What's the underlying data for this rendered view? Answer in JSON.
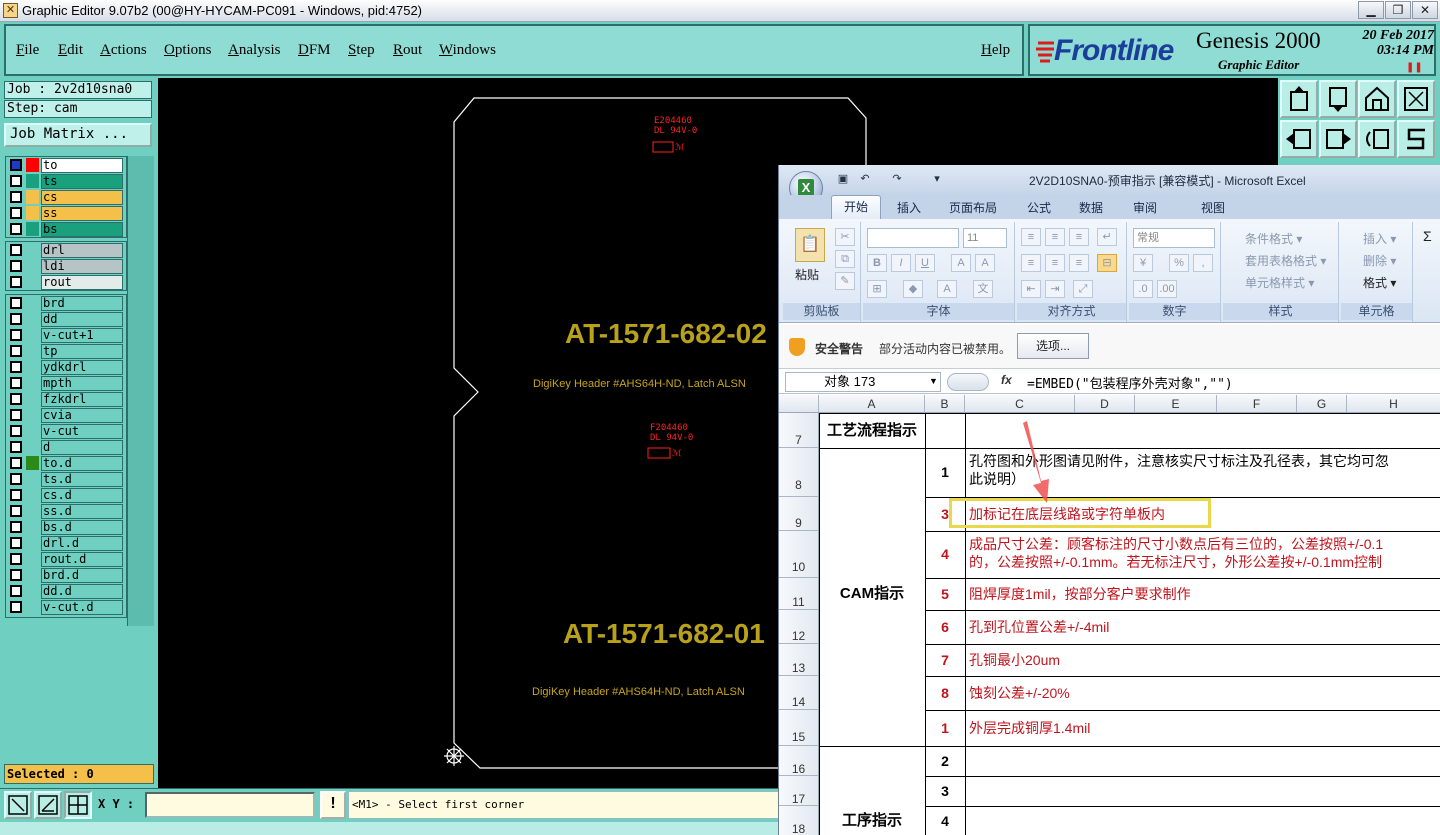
{
  "window": {
    "title": "Graphic Editor 9.07b2 (00@HY-HYCAM-PC091 - Windows, pid:4752)"
  },
  "menu": [
    "File",
    "Edit",
    "Actions",
    "Options",
    "Analysis",
    "DFM",
    "Step",
    "Rout",
    "Windows"
  ],
  "help": "Help",
  "brand": {
    "logo": "Frontline",
    "product": "Genesis 2000",
    "subtitle": "Graphic Editor",
    "date": "20 Feb 2017",
    "time": "03:14 PM"
  },
  "job": {
    "job_line": "Job : 2v2d10sna0",
    "step_line": "Step: cam",
    "matrix_button": "Job Matrix ..."
  },
  "layers": {
    "group1": [
      {
        "name": "to",
        "color": "#ff0000",
        "bg": "#ffffff",
        "active": true
      },
      {
        "name": "ts",
        "color": "#1aa07c",
        "bg": "#1aa07c"
      },
      {
        "name": "cs",
        "color": "#f5c04a",
        "bg": "#f5c04a"
      },
      {
        "name": "ss",
        "color": "#f5c04a",
        "bg": "#f5c04a"
      },
      {
        "name": "bs",
        "color": "#1aa07c",
        "bg": "#1aa07c"
      }
    ],
    "group2": [
      {
        "name": "drl",
        "bg": "#b7c4c6"
      },
      {
        "name": "ldi",
        "bg": "#b7c4c6"
      },
      {
        "name": "rout",
        "bg": "#e4ece9"
      }
    ],
    "group3": [
      {
        "name": "brd"
      },
      {
        "name": "dd"
      },
      {
        "name": "v-cut+1"
      },
      {
        "name": "tp"
      },
      {
        "name": "ydkdrl"
      },
      {
        "name": "mpth"
      },
      {
        "name": "fzkdrl"
      },
      {
        "name": "cvia"
      },
      {
        "name": "v-cut"
      },
      {
        "name": "d"
      },
      {
        "name": "to.d",
        "color": "#2a8a1a"
      },
      {
        "name": "ts.d"
      },
      {
        "name": "cs.d"
      },
      {
        "name": "ss.d"
      },
      {
        "name": "bs.d"
      },
      {
        "name": "drl.d"
      },
      {
        "name": "rout.d"
      },
      {
        "name": "brd.d"
      },
      {
        "name": "dd.d"
      },
      {
        "name": "v-cut.d"
      }
    ]
  },
  "selected": "Selected : 0",
  "canvas": {
    "board_text_1": "AT-1571-682-02",
    "board_sub_1": "DigiKey Header #AHS64H-ND, Latch ALSN",
    "board_text_2": "AT-1571-682-01",
    "board_sub_2": "DigiKey Header #AHS64H-ND, Latch ALSN",
    "mark1_a": "E204460",
    "mark1_b": "DL 94V-0",
    "mark2_a": "F204460",
    "mark2_b": "DL 94V-0"
  },
  "status": {
    "xy_label": "X Y :",
    "input_value": "",
    "prompt": "<M1> - Select first corner"
  },
  "excel": {
    "title": "2V2D10SNA0-预审指示  [兼容模式] - Microsoft Excel",
    "tabs": [
      "开始",
      "插入",
      "页面布局",
      "公式",
      "数据",
      "审阅",
      "视图"
    ],
    "ribbon": {
      "paste": "粘贴",
      "font_size": "11",
      "number_format": "常规",
      "groups": [
        "剪贴板",
        "字体",
        "对齐方式",
        "数字",
        "样式",
        "单元格"
      ],
      "styles": [
        "条件格式 ▾",
        "套用表格格式 ▾",
        "单元格样式 ▾"
      ],
      "cells": [
        "插入 ▾",
        "删除 ▾",
        "格式 ▾"
      ]
    },
    "security": {
      "title": "安全警告",
      "message": "部分活动内容已被禁用。",
      "button": "选项..."
    },
    "name_box": "对象 173",
    "formula": "=EMBED(\"包装程序外壳对象\",\"\")",
    "columns": [
      "A",
      "B",
      "C",
      "D",
      "E",
      "F",
      "G",
      "H"
    ],
    "rows": [
      {
        "num": "7",
        "a": "工艺流程指示",
        "b": "",
        "c": ""
      },
      {
        "num": "8",
        "a": "",
        "b": "1",
        "c": "孔符图和外形图请见附件，注意核实尺寸标注及孔径表，其它均可忽",
        "c2": "此说明）"
      },
      {
        "num": "9",
        "a": "",
        "b": "3",
        "c": "加标记在底层线路或字符单板内"
      },
      {
        "num": "10",
        "a": "",
        "b": "4",
        "c": "成品尺寸公差：顾客标注的尺寸小数点后有三位的，公差按照+/-0.1",
        "c2": "的，公差按照+/-0.1mm。若无标注尺寸，外形公差按+/-0.1mm控制"
      },
      {
        "num": "11",
        "a": "CAM指示",
        "b": "5",
        "c": "阻焊厚度1mil，按部分客户要求制作"
      },
      {
        "num": "12",
        "a": "",
        "b": "6",
        "c": "孔到孔位置公差+/-4mil"
      },
      {
        "num": "13",
        "a": "",
        "b": "7",
        "c": "孔铜最小20um"
      },
      {
        "num": "14",
        "a": "",
        "b": "8",
        "c": "蚀刻公差+/-20%"
      },
      {
        "num": "15",
        "a": "",
        "b": "1",
        "c": "外层完成铜厚1.4mil"
      },
      {
        "num": "16",
        "a": "",
        "b": "2",
        "c": ""
      },
      {
        "num": "17",
        "a": "",
        "b": "3",
        "c": ""
      },
      {
        "num": "18",
        "a": "工序指示",
        "b": "4",
        "c": ""
      }
    ]
  }
}
